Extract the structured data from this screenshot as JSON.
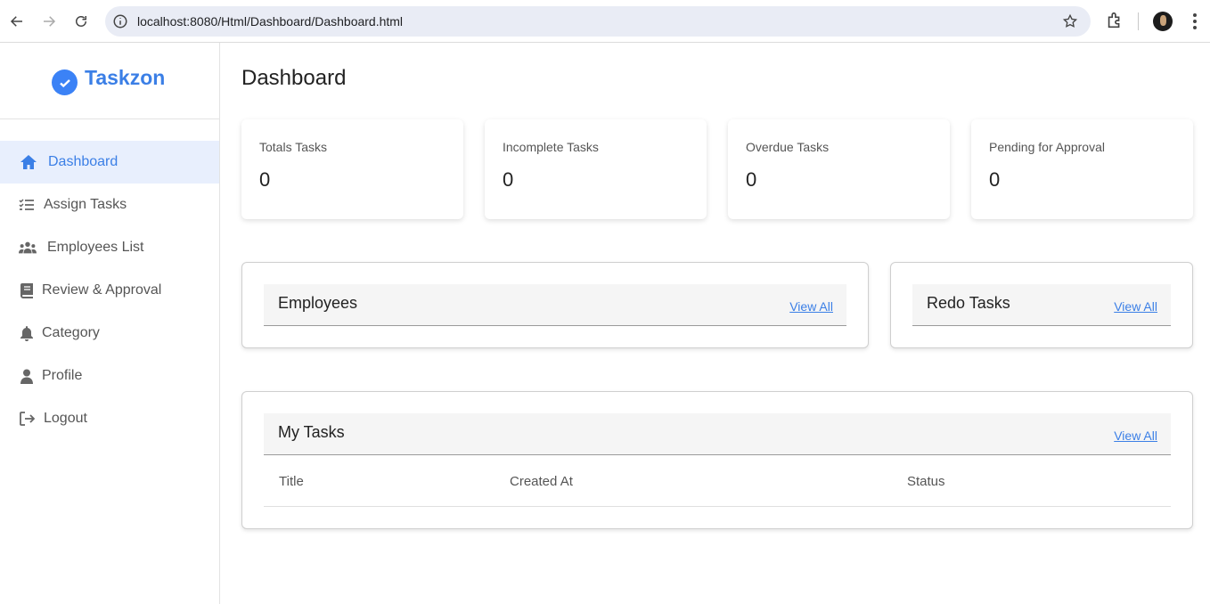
{
  "browser": {
    "url": "localhost:8080/Html/Dashboard/Dashboard.html"
  },
  "sidebar": {
    "brand": "Taskzon",
    "items": [
      {
        "label": "Dashboard",
        "icon": "home-icon",
        "active": true
      },
      {
        "label": "Assign Tasks",
        "icon": "task-list-icon",
        "active": false
      },
      {
        "label": "Employees List",
        "icon": "users-icon",
        "active": false
      },
      {
        "label": "Review & Approval",
        "icon": "book-icon",
        "active": false
      },
      {
        "label": "Category",
        "icon": "bell-icon",
        "active": false
      },
      {
        "label": "Profile",
        "icon": "user-icon",
        "active": false
      },
      {
        "label": "Logout",
        "icon": "logout-icon",
        "active": false
      }
    ]
  },
  "main": {
    "title": "Dashboard",
    "stats": [
      {
        "label": "Totals Tasks",
        "value": "0"
      },
      {
        "label": "Incomplete Tasks",
        "value": "0"
      },
      {
        "label": "Overdue Tasks",
        "value": "0"
      },
      {
        "label": "Pending for Approval",
        "value": "0"
      }
    ],
    "employees_panel": {
      "title": "Employees",
      "link": "View All"
    },
    "redo_panel": {
      "title": "Redo Tasks",
      "link": "View All"
    },
    "tasks_panel": {
      "title": "My Tasks",
      "link": "View All",
      "columns": [
        "Title",
        "Created At",
        "Status"
      ]
    }
  },
  "colors": {
    "accent": "#3b7fe6",
    "active_bg": "#e8effd"
  }
}
